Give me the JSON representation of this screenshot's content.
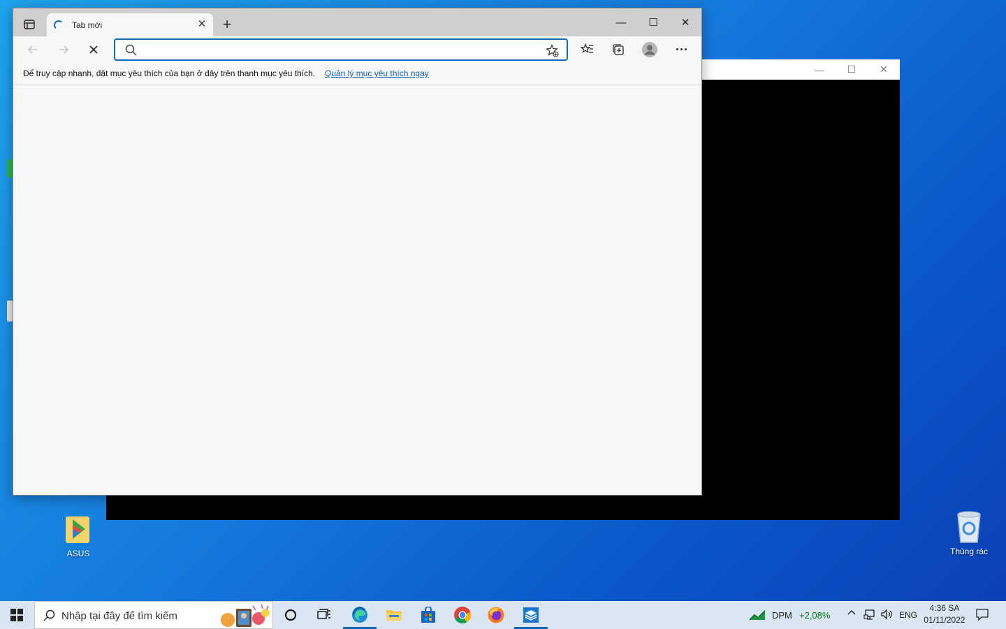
{
  "desktop": {
    "icons": [
      {
        "label": "ASUS"
      },
      {
        "label": "Thùng rác"
      }
    ]
  },
  "browser": {
    "tab": {
      "title": "Tab mới",
      "close": "✕"
    },
    "new_tab": "+",
    "window_controls": {
      "minimize": "—",
      "maximize": "☐",
      "close": "✕"
    },
    "address": {
      "value": "",
      "placeholder": ""
    },
    "favorites_bar": {
      "message": "Để truy cập nhanh, đặt mục yêu thích của bạn ở đây trên thanh mục yêu thích.",
      "link": "Quản lý mục yêu thích ngay"
    },
    "more_menu": "···"
  },
  "background_window": {
    "controls": {
      "minimize": "—",
      "maximize": "☐",
      "close": "✕"
    }
  },
  "taskbar": {
    "search_placeholder": "Nhập tại đây để tìm kiếm",
    "stock": {
      "symbol": "DPM",
      "change": "+2,08%",
      "change_color": "#107c10"
    },
    "language": "ENG",
    "time": "4:36 SA",
    "date": "01/11/2022"
  },
  "colors": {
    "accent": "#0f6cbd",
    "taskbar": "#dbe6f4"
  }
}
